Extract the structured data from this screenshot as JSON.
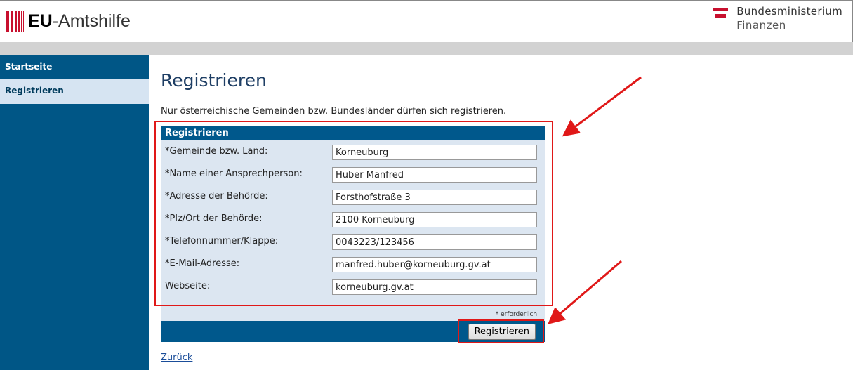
{
  "header": {
    "logo_bold": "EU",
    "logo_rest": "-Amtshilfe",
    "ministry_line1": "Bundesministerium",
    "ministry_line2": "Finanzen"
  },
  "sidebar": {
    "items": [
      {
        "label": "Startseite",
        "active": false
      },
      {
        "label": "Registrieren",
        "active": true
      }
    ]
  },
  "main": {
    "title": "Registrieren",
    "intro": "Nur österreichische Gemeinden bzw. Bundesländer dürfen sich registrieren.",
    "form": {
      "heading": "Registrieren",
      "fields": [
        {
          "label": "*Gemeinde bzw. Land:",
          "value": "Korneuburg"
        },
        {
          "label": "*Name einer Ansprechperson:",
          "value": "Huber Manfred"
        },
        {
          "label": "*Adresse der Behörde:",
          "value": "Forsthofstraße 3"
        },
        {
          "label": "*Plz/Ort der Behörde:",
          "value": "2100 Korneuburg"
        },
        {
          "label": "*Telefonnummer/Klappe:",
          "value": "0043223/123456"
        },
        {
          "label": "*E-Mail-Adresse:",
          "value": "manfred.huber@korneuburg.gv.at"
        },
        {
          "label": "Webseite:",
          "value": "korneuburg.gv.at"
        }
      ],
      "required_note": "* erforderlich.",
      "submit_label": "Registrieren"
    },
    "back_link": "Zurück"
  },
  "colors": {
    "brand_red": "#c8102e",
    "nav_blue": "#005686",
    "annotation_red": "#e01818"
  }
}
